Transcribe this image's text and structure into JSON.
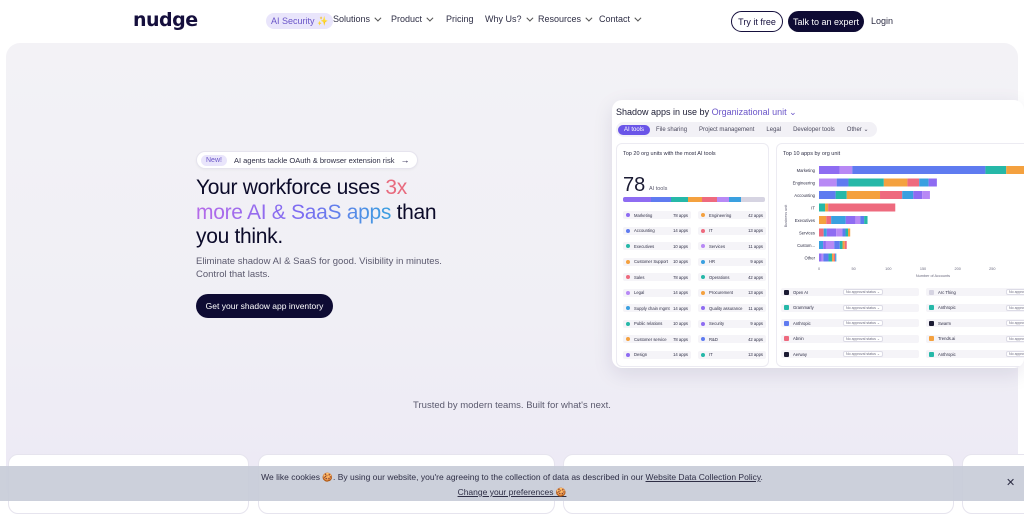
{
  "nav": {
    "logo": "nudge",
    "ai_security": "AI Security ✨",
    "solutions": "Solutions",
    "product": "Product",
    "pricing": "Pricing",
    "why_us": "Why Us?",
    "resources": "Resources",
    "contact": "Contact",
    "try_free": "Try it free",
    "talk_expert": "Talk to an expert",
    "login": "Login"
  },
  "hero": {
    "badge_new": "New!",
    "badge_text": "AI agents tackle OAuth & browser extension risk",
    "headline_1": "Your workforce uses ",
    "headline_3x": "3x",
    "headline_more": "more AI & SaaS apps",
    "headline_than": " than",
    "headline_2": "you think.",
    "subtext": "Eliminate shadow AI & SaaS for good. Visibility in minutes. Control that lasts.",
    "cta": "Get your shadow app inventory"
  },
  "panel": {
    "title_prefix": "Shadow apps in use by ",
    "title_unit": "Organizational unit ⌄",
    "tabs": [
      "AI tools",
      "File sharing",
      "Project management",
      "Legal",
      "Developer tools",
      "Other ⌄"
    ],
    "left_head": "Top 20 org units with the most AI tools",
    "right_head": "Top 10 apps by org unit",
    "big_number": "78",
    "big_label": "AI tools",
    "org_units": [
      {
        "name": "Marketing",
        "count": "78 apps",
        "name2": "Engineering",
        "count2": "42 apps"
      },
      {
        "name": "Accounting",
        "count": "14 apps",
        "name2": "IT",
        "count2": "13 apps"
      },
      {
        "name": "Executives",
        "count": "10 apps",
        "name2": "Services",
        "count2": "11 apps"
      },
      {
        "name": "Customer Support",
        "count": "10 apps",
        "name2": "HR",
        "count2": "9 apps"
      },
      {
        "name": "Sales",
        "count": "78 apps",
        "name2": "Operations",
        "count2": "42 apps"
      },
      {
        "name": "Legal",
        "count": "14 apps",
        "name2": "Procurement",
        "count2": "13 apps"
      },
      {
        "name": "Supply chain mgmt",
        "count": "14 apps",
        "name2": "Quality assurance",
        "count2": "11 apps"
      },
      {
        "name": "Public relations",
        "count": "10 apps",
        "name2": "Security",
        "count2": "9 apps"
      },
      {
        "name": "Customer service",
        "count": "78 apps",
        "name2": "R&D",
        "count2": "42 apps"
      },
      {
        "name": "Design",
        "count": "14 apps",
        "name2": "IT",
        "count2": "13 apps"
      }
    ],
    "apps": [
      {
        "name": "Open AI",
        "status": "No approval status ⌄",
        "name2": "Arc Thing",
        "status2": "No approv"
      },
      {
        "name": "Grammarly",
        "status": "No approval status ⌄",
        "name2": "Anthropic",
        "status2": "No approv"
      },
      {
        "name": "Anthropic",
        "status": "No approval status ⌄",
        "name2": "Swarm",
        "status2": "No approv"
      },
      {
        "name": "Abnin",
        "status": "No approval status ⌄",
        "name2": "Trends.ai",
        "status2": "No approv"
      },
      {
        "name": "Aerway",
        "status": "No approval status ⌄",
        "name2": "Anthropic",
        "status2": "No approv"
      }
    ],
    "y_axis_label": "Business unit",
    "x_axis_label": "Number of Accounts"
  },
  "chart_data": {
    "type": "bar",
    "title": "Top 10 apps by org unit",
    "categories": [
      "Marketing",
      "Engineering",
      "Accounting",
      "IT",
      "Executives",
      "Services",
      "Custom...",
      "Other"
    ],
    "values": [
      300,
      170,
      160,
      110,
      70,
      45,
      40,
      25
    ],
    "xticks": [
      "0",
      "50",
      "100",
      "150",
      "200",
      "250",
      "300"
    ],
    "xlim": [
      0,
      300
    ],
    "xlabel": "Number of Accounts",
    "ylabel": "Business unit",
    "orientation": "horizontal"
  },
  "trusted": "Trusted by modern teams. Built for what's next.",
  "cookie": {
    "text_before": "We like cookies 🍪. By using our website, you're agreeing to the collection of data as described in our ",
    "policy_link": "Website Data Collection Policy",
    "text_after": ".",
    "change_prefs": "Change your preferences 🍪",
    "close": "✕"
  },
  "colors": {
    "primary_dark": "#0e0b33",
    "accent_purple": "#6a55e8",
    "accent_light": "#e9e5fb"
  }
}
